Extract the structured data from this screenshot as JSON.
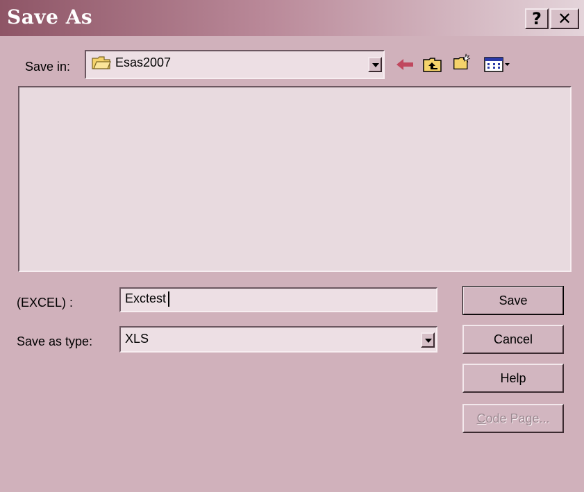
{
  "window": {
    "title": "Save As",
    "help_button": "?",
    "close_button": "✕"
  },
  "save_in": {
    "label": "Save in:",
    "folder": "Esas2007"
  },
  "toolbar": {
    "icons": [
      "back-arrow-icon",
      "up-folder-icon",
      "new-folder-icon",
      "view-menu-icon"
    ]
  },
  "file_list": {
    "items": []
  },
  "filename": {
    "label": "(EXCEL) :",
    "value": "Exctest"
  },
  "save_type": {
    "label": "Save as type:",
    "selected": "XLS"
  },
  "buttons": {
    "save": "Save",
    "cancel": "Cancel",
    "help": "Help",
    "code_page": "Code Page..."
  },
  "colors": {
    "window_bg": "#d0b1bb",
    "title_gradient_start": "#8e5566",
    "back_arrow": "#c0485e"
  }
}
